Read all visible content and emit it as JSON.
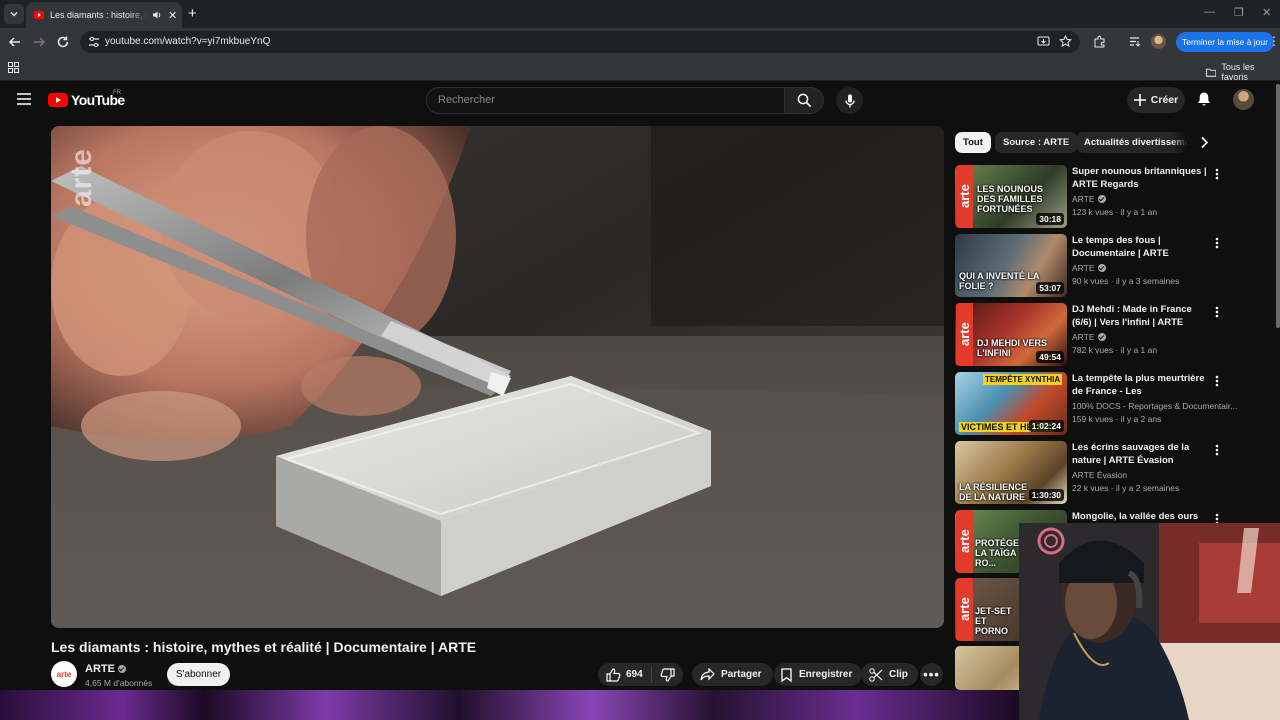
{
  "browser": {
    "tab_title": "Les diamants : histoire, mythes et réalité | Documentaire | ARTE",
    "url": "youtube.com/watch?v=yi7mkbueYnQ",
    "update_button": "Terminer la mise à jour",
    "bookmarks_folder": "Tous les favoris"
  },
  "youtube": {
    "logo_text": "YouTube",
    "country_code": "FR",
    "search_placeholder": "Rechercher",
    "create_label": "Créer"
  },
  "video": {
    "title": "Les diamants : histoire, mythes et réalité | Documentaire | ARTE",
    "watermark": "arte",
    "channel": "ARTE",
    "channel_logo": "arte",
    "subscribers": "4,65 M d'abonnés",
    "subscribe_label": "S'abonner",
    "likes": "694",
    "share_label": "Partager",
    "save_label": "Enregistrer",
    "clip_label": "Clip"
  },
  "chips": [
    "Tout",
    "Source : ARTE",
    "Actualités divertissement"
  ],
  "recommendations": [
    {
      "title": "Super nounous britanniques | ARTE Regards",
      "channel": "ARTE",
      "verified": true,
      "views": "123 k vues",
      "age": "il y a 1 an",
      "duration": "30:18",
      "thumb_text": "LES NOUNOUS DES FAMILLES FORTUNÉES",
      "thumb_color": "#4b6a3c"
    },
    {
      "title": "Le temps des fous | Documentaire | ARTE",
      "channel": "ARTE",
      "verified": true,
      "views": "90 k vues",
      "age": "il y a 3 semaines",
      "duration": "53:07",
      "thumb_text": "QUI A INVENTÉ LA FOLIE ?",
      "thumb_color": "#3a4a55"
    },
    {
      "title": "DJ Mehdi : Made in France (6/6) | Vers l'infini | ARTE",
      "channel": "ARTE",
      "verified": true,
      "views": "782 k vues",
      "age": "il y a 1 an",
      "duration": "49:54",
      "thumb_text": "DJ MEHDI VERS L'INFINI",
      "thumb_color": "#8a2a26"
    },
    {
      "title": "La tempête la plus meurtrière de France - Les conséquences...",
      "channel": "100% DOCS - Reportages & Documentair...",
      "verified": false,
      "views": "159 k vues",
      "age": "il y a 2 ans",
      "duration": "1:02:24",
      "thumb_text": "VICTIMES ET HÉROS",
      "thumb_banner": "TEMPÊTE XYNTHIA",
      "thumb_color": "#3d7fa0"
    },
    {
      "title": "Les écrins sauvages de la nature | ARTE Évasion",
      "channel": "ARTE Évasion",
      "verified": false,
      "views": "22 k vues",
      "age": "il y a 2 semaines",
      "duration": "1:30:30",
      "thumb_text": "LA RÉSILIENCE DE LA NATURE",
      "thumb_color": "#7a5a35"
    },
    {
      "title": "Mongolie, la vallée des ours |",
      "thumb_text": "PROTÉGER LA TAÏGA RO...",
      "thumb_color": "#4d6b3a"
    },
    {
      "thumb_text": "JET-SET ET PORNO",
      "thumb_color": "#5b4538"
    }
  ]
}
